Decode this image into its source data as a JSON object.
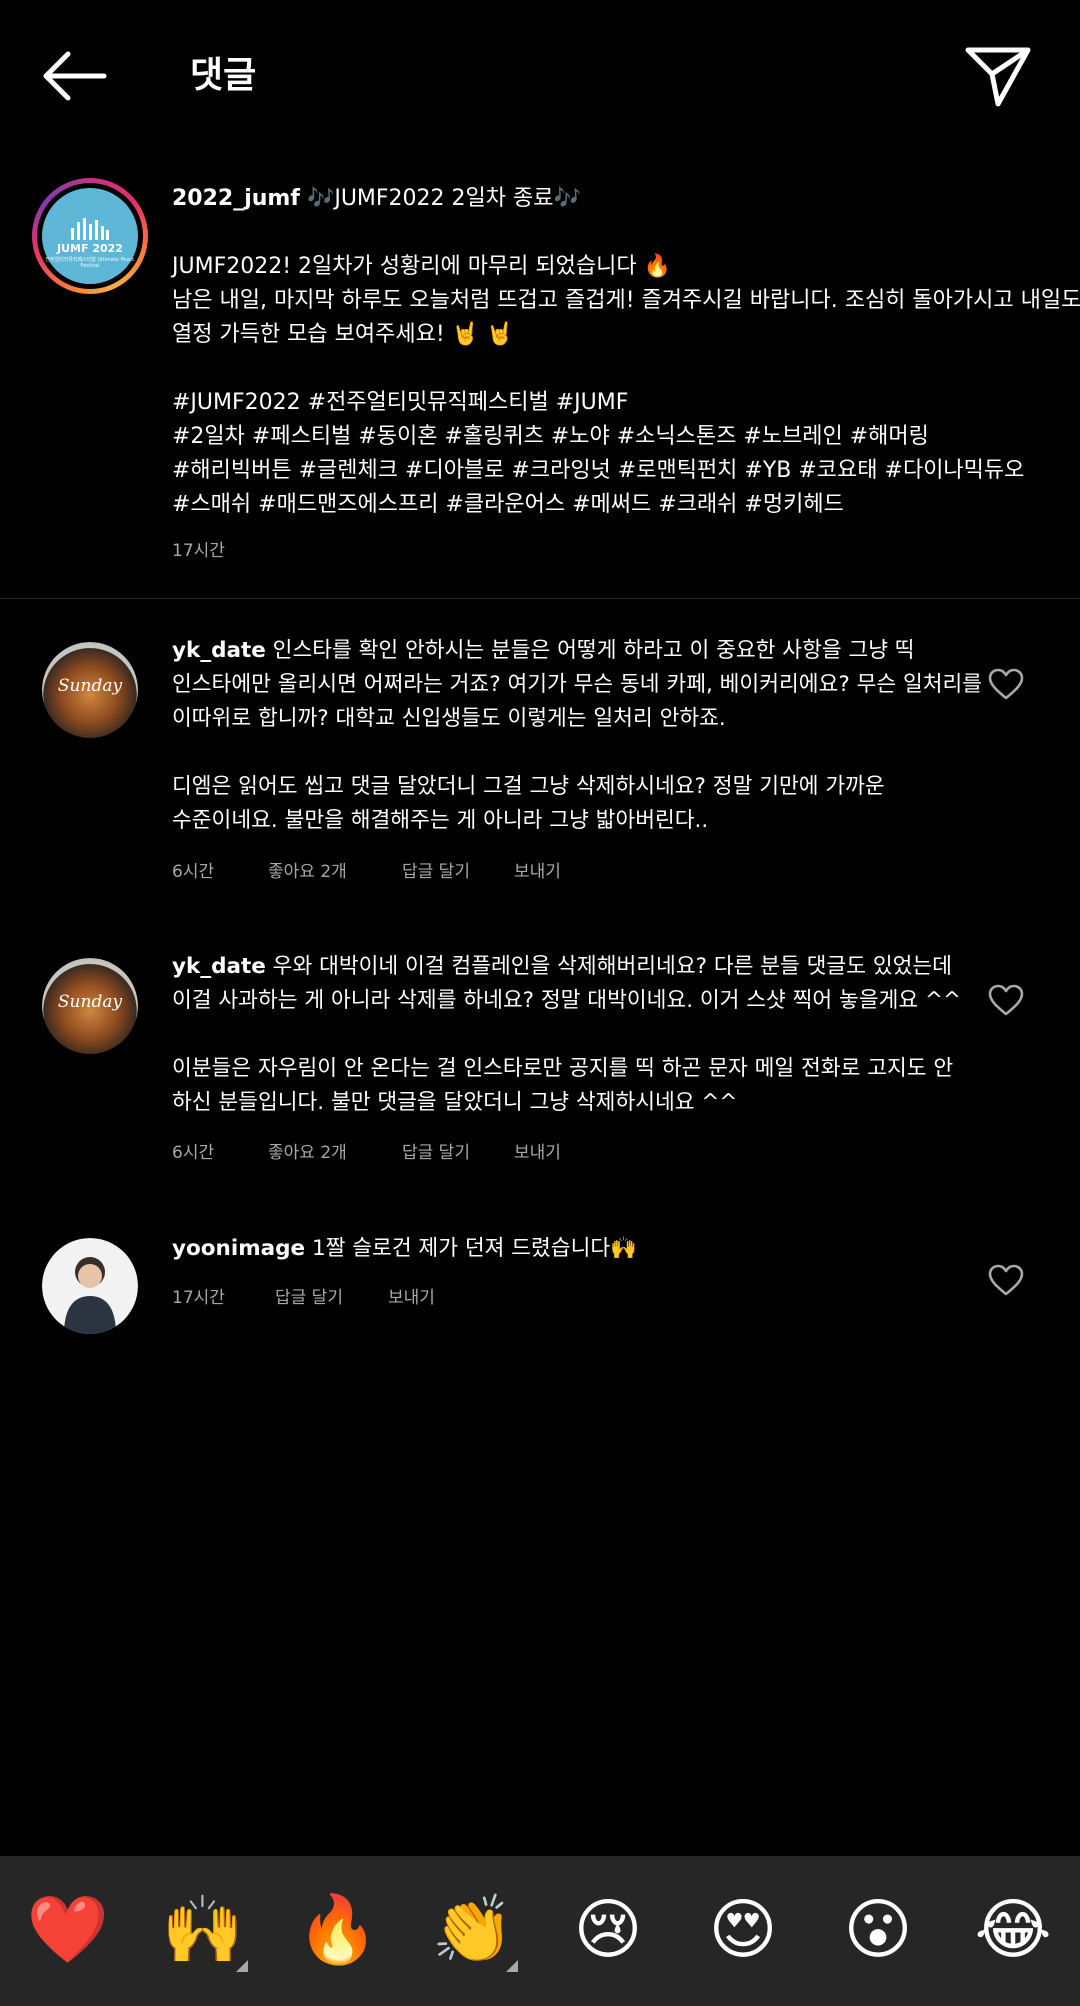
{
  "header": {
    "title": "댓글"
  },
  "post": {
    "username": "2022_jumf",
    "logo_text": "JUMF 2022",
    "logo_sub": "전주얼티밋뮤직페스티벌 Ultimate Music Festival",
    "caption_lines": [
      "🎶JUMF2022 2일차 종료🎶",
      "",
      "JUMF2022! 2일차가 성황리에 마무리 되었습니다 🔥",
      "남은 내일, 마지막 하루도 오늘처럼 뜨겁고 즐겁게! 즐겨주시길 바랍니다. 조심히 돌아가시고 내일도",
      "열정 가득한 모습 보여주세요! 🤘 🤘",
      "",
      "#JUMF2022 #전주얼티밋뮤직페스티벌 #JUMF",
      "#2일차 #페스티벌 #동이혼 #홀링퀴츠 #노야 #소닉스톤즈 #노브레인 #해머링",
      "#해리빅버튼 #글렌체크 #디아블로 #크라잉넛 #로맨틱펀치 #YB #코요태 #다이나믹듀오",
      "#스매쉬 #매드맨즈에스프리 #클라운어스 #메써드 #크래쉬 #멍키헤드"
    ],
    "time": "17시간"
  },
  "comments": [
    {
      "username": "yk_date",
      "avatar_label": "Sunday",
      "lines": [
        "인스타를 확인 안하시는 분들은 어떻게 하라고 이 중요한 사항을 그냥 띡",
        "인스타에만 올리시면 어쩌라는 거죠? 여기가 무슨 동네 카페, 베이커리에요? 무슨 일처리를",
        "이따위로 합니까? 대학교 신입생들도 이렇게는 일처리 안하죠.",
        "",
        "디엠은 읽어도 씹고 댓글 달았더니 그걸 그냥 삭제하시네요? 정말 기만에 가까운",
        "수준이네요. 불만을 해결해주는 게 아니라 그냥 밟아버린다.."
      ],
      "time": "6시간",
      "likes": "좋아요 2개",
      "reply": "답글 달기",
      "send": "보내기"
    },
    {
      "username": "yk_date",
      "avatar_label": "Sunday",
      "lines": [
        "우와 대박이네 이걸 컴플레인을 삭제해버리네요?   다른 분들 댓글도 있었는데",
        "이걸 사과하는 게 아니라 삭제를 하네요? 정말 대박이네요. 이거 스샷 찍어 놓을게요 ^^",
        "",
        "이분들은 자우림이 안 온다는 걸 인스타로만 공지를 띡 하곤 문자 메일 전화로 고지도 안",
        "하신 분들입니다. 불만 댓글을 달았더니 그냥 삭제하시네요 ^^"
      ],
      "time": "6시간",
      "likes": "좋아요 2개",
      "reply": "답글 달기",
      "send": "보내기"
    },
    {
      "username": "yoonimage",
      "lines": [
        "1짤 슬로건 제가 던져 드렸습니다🙌"
      ],
      "time": "17시간",
      "reply": "답글 달기",
      "send": "보내기"
    }
  ],
  "emoji_bar": [
    "❤️",
    "🙌",
    "🔥",
    "👏",
    "😢",
    "😍",
    "😮",
    "😂"
  ],
  "colors": {
    "background": "#000000",
    "secondary_text": "#a8a8a8",
    "emoji_bar_bg": "#262626"
  }
}
